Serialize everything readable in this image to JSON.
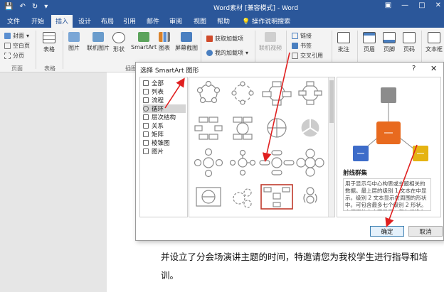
{
  "titlebar": {
    "title": "Word素材 [兼容模式] - Word"
  },
  "tabs": [
    {
      "label": "文件"
    },
    {
      "label": "开始"
    },
    {
      "label": "插入"
    },
    {
      "label": "设计"
    },
    {
      "label": "布局"
    },
    {
      "label": "引用"
    },
    {
      "label": "邮件"
    },
    {
      "label": "审阅"
    },
    {
      "label": "视图"
    },
    {
      "label": "帮助"
    }
  ],
  "tell_me": "操作说明搜索",
  "ribbon": {
    "pages": {
      "cover": "封面",
      "blank": "空白页",
      "break": "分页",
      "group": "页面"
    },
    "table": {
      "label": "表格",
      "group": "表格"
    },
    "illus": {
      "picture": "图片",
      "online": "联机图片",
      "shapes": "形状",
      "smartart": "SmartArt",
      "chart": "图表",
      "screenshot": "屏幕截图",
      "group": "插图"
    },
    "addins": {
      "get": "获取加载项",
      "my": "我的加载项"
    },
    "media": {
      "video": "联机视频"
    },
    "links": {
      "link": "链接",
      "bookmark": "书签",
      "crossref": "交叉引用"
    },
    "comments": {
      "comment": "批注"
    },
    "header": {
      "header": "页眉",
      "footer": "页脚",
      "pagenum": "页码"
    },
    "text": {
      "textbox": "文本框"
    }
  },
  "dialog": {
    "title": "选择 SmartArt 图形",
    "help": "?",
    "categories": [
      {
        "label": "全部"
      },
      {
        "label": "列表"
      },
      {
        "label": "流程"
      },
      {
        "label": "循环"
      },
      {
        "label": "层次结构"
      },
      {
        "label": "关系"
      },
      {
        "label": "矩阵"
      },
      {
        "label": "棱锥图"
      },
      {
        "label": "图片"
      }
    ],
    "selected_category": "循环",
    "preview_name": "射线群集",
    "preview_desc": "用于显示与中心构思或主题相关的数据。最上层的级别 1 文本在中显示。级别 2 文本显示在周围的形状中。可包含最多七个级别 2 形状。未使用的文本不显示，但在切换布局时仍可用。",
    "ok": "确定",
    "cancel": "取消"
  },
  "document": {
    "line1": "并设立了分会场演讲主题的时间，特邀请您为我校学生进行指导和培",
    "line2": "训。"
  }
}
